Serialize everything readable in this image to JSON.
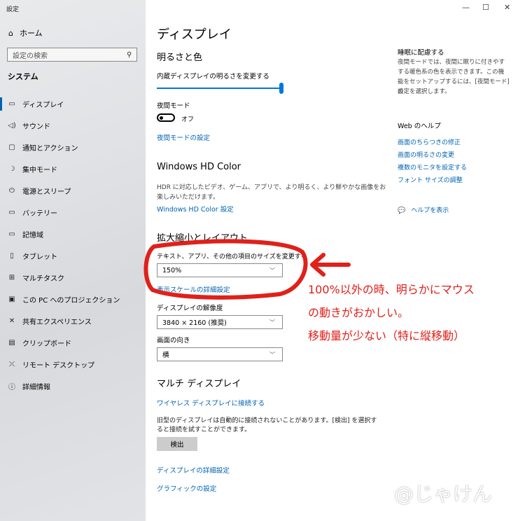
{
  "sidebar": {
    "app_title": "設定",
    "home": "ホーム",
    "search_placeholder": "設定の検索",
    "section": "システム",
    "items": [
      {
        "label": "ディスプレイ",
        "icon": "monitor-icon",
        "active": true
      },
      {
        "label": "サウンド",
        "icon": "speaker-icon"
      },
      {
        "label": "通知とアクション",
        "icon": "notification-icon"
      },
      {
        "label": "集中モード",
        "icon": "moon-icon"
      },
      {
        "label": "電源とスリープ",
        "icon": "power-icon"
      },
      {
        "label": "バッテリー",
        "icon": "battery-icon"
      },
      {
        "label": "記憶域",
        "icon": "storage-icon"
      },
      {
        "label": "タブレット",
        "icon": "tablet-icon"
      },
      {
        "label": "マルチタスク",
        "icon": "multitask-icon"
      },
      {
        "label": "この PC へのプロジェクション",
        "icon": "projection-icon"
      },
      {
        "label": "共有エクスペリエンス",
        "icon": "share-icon"
      },
      {
        "label": "クリップボード",
        "icon": "clipboard-icon"
      },
      {
        "label": "リモート デスクトップ",
        "icon": "remote-icon"
      },
      {
        "label": "詳細情報",
        "icon": "info-icon"
      }
    ]
  },
  "window": {
    "minimize": "—",
    "maximize": "☐",
    "close": "✕"
  },
  "main": {
    "title": "ディスプレイ",
    "brightness": {
      "heading": "明るさと色",
      "label": "内蔵ディスプレイの明るさを変更する",
      "level": 1.0
    },
    "night": {
      "label": "夜間モード",
      "state": "オフ",
      "link": "夜間モードの設定"
    },
    "hdr": {
      "heading": "Windows HD Color",
      "desc1": "HDR に対応したビデオ、ゲーム、アプリで、より明るく、より鮮やかな画像をお",
      "desc2": "楽しみいただけます。",
      "link": "Windows HD Color 設定"
    },
    "scale": {
      "heading": "拡大縮小とレイアウト",
      "label": "テキスト、アプリ、その他の項目のサイズを変更する",
      "value": "150%",
      "link": "表示スケールの詳細設定"
    },
    "resolution": {
      "label": "ディスプレイの解像度",
      "value": "3840 × 2160 (推奨)"
    },
    "orientation": {
      "label": "画面の向き",
      "value": "横"
    },
    "multi": {
      "heading": "マルチ ディスプレイ",
      "link": "ワイヤレス ディスプレイに接続する",
      "desc1": "旧型のディスプレイは自動的に接続されないことがあります。[検出] を選択す",
      "desc2": "ると接続を試すことができます。",
      "button": "検出",
      "link2": "ディスプレイの詳細設定",
      "link3": "グラフィックの設定"
    }
  },
  "side": {
    "sleep_heading": "睡眠に配慮する",
    "sleep_desc": [
      "夜間モードでは、夜間に眠りに付きやす",
      "する暖色系の色を表示できます。この機",
      "能をセットアップするには、[夜間モード] の",
      "設定を選択します。"
    ],
    "help_heading": "Web のヘルプ",
    "help_links": [
      "画面のちらつきの修正",
      "画面の明るさの変更",
      "複数のモニタを設定する",
      "フォント サイズの調整"
    ],
    "help_button": "ヘルプを表示"
  },
  "annotation": {
    "line1": "100%以外の時、明らかにマウス",
    "line2": "の動きがおかしい。",
    "line3": "移動量が少ない（特に縦移動）",
    "color": "#e0201a"
  },
  "watermark": "@じゃけん",
  "colors": {
    "accent": "#0078d7",
    "link": "#0063b1"
  }
}
